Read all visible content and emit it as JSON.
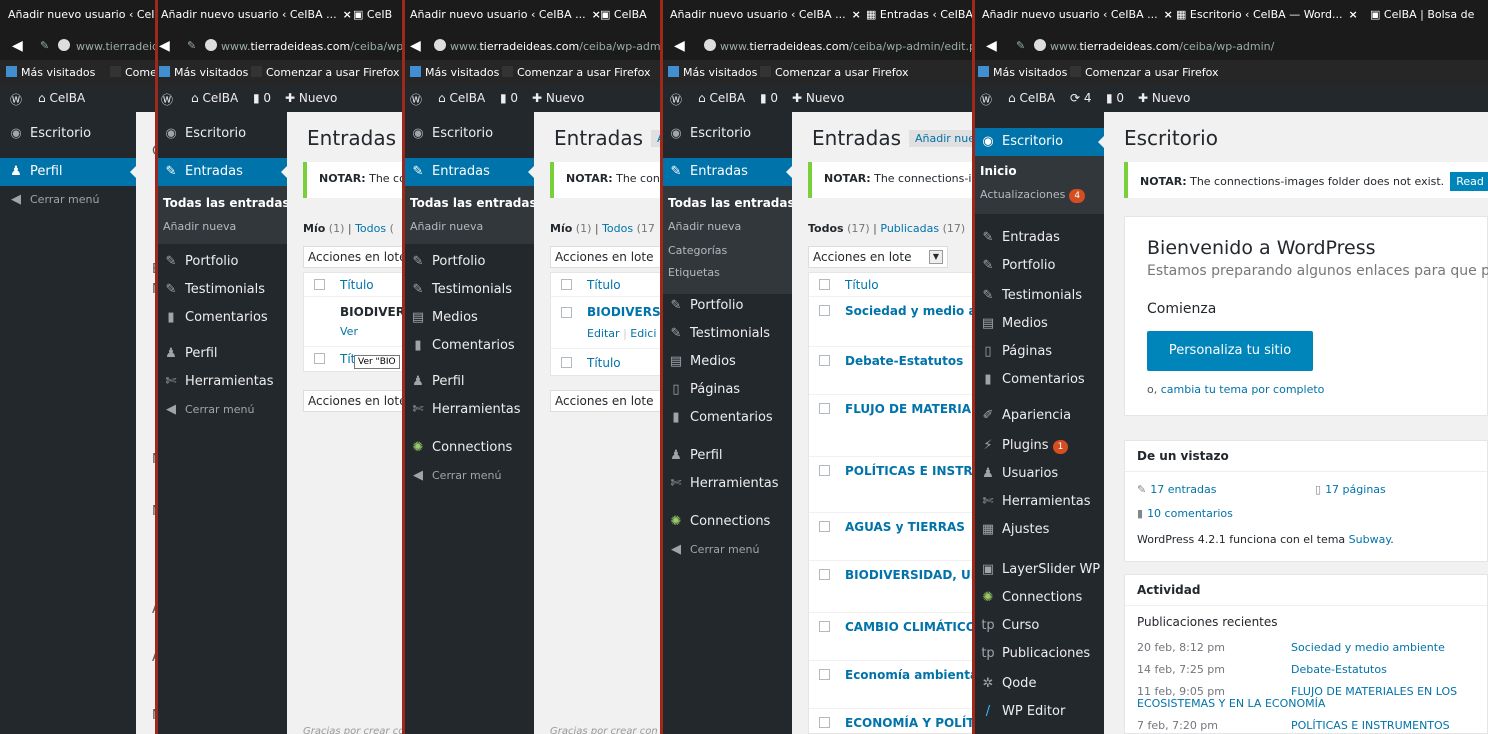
{
  "tabs": {
    "t1": "Añadir nuevo usuario ‹ CeIBA",
    "t2": "Añadir nuevo usuario ‹ CeIBA ...",
    "t2_next": "CeIB",
    "t3": "Añadir nuevo usuario ‹ CeIBA ...",
    "t3_next": "CeIBA",
    "t4": "Añadir nuevo usuario ‹ CeIBA ...",
    "t4_next": "Entradas ‹ CeIBA",
    "t5": "Añadir nuevo usuario ‹ CeIBA ...",
    "t5_next": "Escritorio ‹ CeIBA — Word...",
    "t5_third": "CeIBA | Bolsa de",
    "close": "×"
  },
  "urls": {
    "u1_host": "www.tierradeid",
    "u2_prefix": "www.",
    "u2_host": "tierradeideas.com",
    "u2_path": "/ceiba/wp",
    "u3_prefix": "www.",
    "u3_host": "tierradeideas.com",
    "u3_path": "/ceiba/wp-admin",
    "u4_prefix": "www.",
    "u4_host": "tierradeideas.com",
    "u4_path": "/ceiba/wp-admin/edit.php",
    "u5_prefix": "www.",
    "u5_host": "tierradeideas.com",
    "u5_path": "/ceiba/wp-admin/"
  },
  "bookmarks": {
    "visited": "Más visitados",
    "firefox": "Comenzar a usar Firefox",
    "firefox_cut": "Comenza"
  },
  "adminbar": {
    "site": "CeIBA",
    "comments_count": "0",
    "new": "Nuevo",
    "updates_count": "4"
  },
  "menu": {
    "escritorio": "Escritorio",
    "perfil": "Perfil",
    "cerrar": "Cerrar menú",
    "entradas": "Entradas",
    "todas": "Todas las entradas",
    "anadir": "Añadir nueva",
    "categorias": "Categorías",
    "etiquetas": "Etiquetas",
    "portfolio": "Portfolio",
    "testimonials": "Testimonials",
    "comentarios": "Comentarios",
    "herramientas": "Herramientas",
    "medios": "Medios",
    "paginas": "Páginas",
    "connections": "Connections",
    "inicio": "Inicio",
    "actualizaciones": "Actualizaciones",
    "apariencia": "Apariencia",
    "plugins": "Plugins",
    "plugins_badge": "1",
    "usuarios": "Usuarios",
    "ajustes": "Ajustes",
    "layerslider": "LayerSlider WP",
    "curso": "Curso",
    "publicaciones": "Publicaciones",
    "qode": "Qode",
    "wpeditor": "WP Editor"
  },
  "posts": {
    "title": "Entradas",
    "add_new": "Añadir nue",
    "add_new_short": "A",
    "notice": "NOTAR:",
    "notice_rest_a": "The conn",
    "notice_rest_b": "The conn",
    "notice_rest_c": "The connections-im",
    "mine": "Mío",
    "mine_count": "(1)",
    "all": "Todos",
    "all_count_a": "(",
    "all_count_b": "(17",
    "all_count_c": "(17)",
    "published": "Publicadas",
    "published_count": "(17)",
    "bulk": "Acciones en lote",
    "bulk_short": "Acciones en lote",
    "col_title": "Título",
    "bio_a": "BIODIVERS",
    "bio_b": "BIODIVERSI",
    "ver": "Ver",
    "editar": "Editar",
    "edicion": "Edici",
    "tooltip": "Ver \"BIO",
    "tit_cut": "Tít",
    "footer": "Gracias por crear con",
    "rows": [
      "Sociedad y medio am",
      "Debate-Estatutos",
      "FLUJO DE MATERIALI",
      "POLÍTICAS E INSTRUM",
      "AGUAS y TIERRAS",
      "BIODIVERSIDAD, UN",
      "CAMBIO CLIMÁTICO",
      "Economía ambiental",
      "ECONOMÍA Y POLÍTIC"
    ]
  },
  "strip1_content": {
    "letters": [
      "C",
      "E",
      "N",
      "N",
      "N",
      "A",
      "A",
      "N"
    ]
  },
  "dashboard": {
    "title": "Escritorio",
    "notice_text": "The connections-images folder does not exist.",
    "read_more": "Read mo",
    "welcome": "Bienvenido a WordPress",
    "welcome_sub": "Estamos preparando algunos enlaces para que pued",
    "comienza": "Comienza",
    "customize": "Personaliza tu sitio",
    "alt_prefix": "o,",
    "alt_link": "cambia tu tema por completo",
    "glance_title": "De un vistazo",
    "posts_count": "17 entradas",
    "pages_count": "17 páginas",
    "comments_count": "10 comentarios",
    "version_text": "WordPress 4.2.1 funciona con el tema",
    "theme": "Subway",
    "activity_title": "Actividad",
    "recent": "Publicaciones recientes",
    "activity": [
      {
        "date": "20 feb, 8:12 pm",
        "title": "Sociedad y medio ambiente"
      },
      {
        "date": "14 feb, 7:25 pm",
        "title": "Debate-Estatutos"
      },
      {
        "date": "11 feb, 9:05 pm",
        "title": "FLUJO DE MATERIALES EN LOS"
      },
      {
        "date": "",
        "title": "ECOSISTEMAS Y EN LA ECONOMÍA"
      },
      {
        "date": "7 feb, 7:20 pm",
        "title": "POLÍTICAS E INSTRUMENTOS"
      }
    ]
  }
}
